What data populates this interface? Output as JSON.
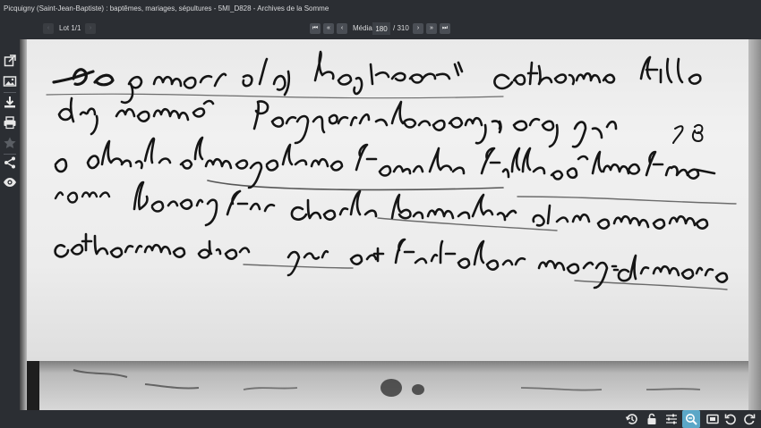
{
  "window": {
    "title": "Picquigny (Saint-Jean-Baptiste) : baptêmes, mariages, sépultures - 5MI_D828 - Archives de la Somme"
  },
  "navigation": {
    "lot_label": "Lot 1/1",
    "media_label": "Média",
    "media_value": "180",
    "media_total": "/ 310",
    "first_glyph": "⏮",
    "prev_fast_glyph": "«",
    "prev_glyph": "‹",
    "next_glyph": "›",
    "next_fast_glyph": "»",
    "last_glyph": "⏭",
    "lot_prev_glyph": "‹",
    "lot_next_glyph": "›"
  },
  "sidebar": {
    "icons": [
      "external-link-icon",
      "image-icon",
      "download-icon",
      "print-icon",
      "star-icon",
      "share-icon",
      "eye-icon"
    ]
  },
  "toolbar": {
    "icons": [
      "history-icon",
      "lock-icon",
      "sliders-icon",
      "zoom-icon",
      "fit-screen-icon",
      "rotate-left-icon",
      "rotate-right-icon"
    ],
    "active": "zoom-icon",
    "accent_color": "#5ba7c7"
  },
  "document": {
    "lines": [
      "Le 9e mars a esté baptisée catherine fille",
      "d'un nommé pasquerie garde du corps du roy qui",
      "a abusé de magdeleine fouache fille née le meme",
      "iour le parain fut charle pennelier et la maraine",
      "catherine dieu qui ont faitz leur marq ordinaire"
    ],
    "margin_note": "7 8"
  }
}
